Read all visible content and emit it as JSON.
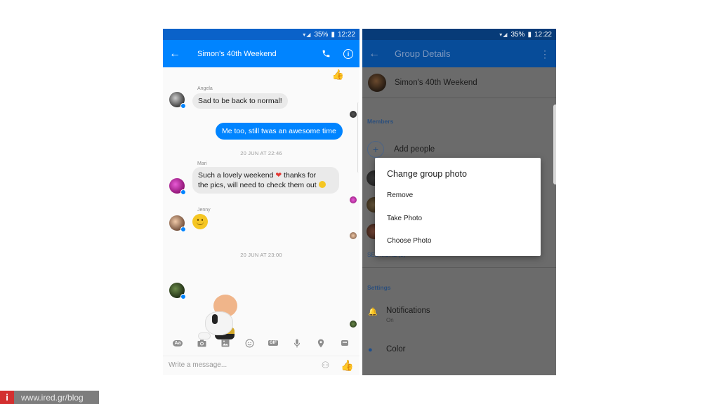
{
  "left_screen": {
    "status_bar": {
      "signal": "WiFi / signal",
      "battery": "35%",
      "time": "12:22"
    },
    "header": {
      "title": "Simon's 40th Weekend"
    },
    "colors": {
      "accent": "#0084ff",
      "status_bar": "#0a62c9",
      "incoming_bubble": "#eaeaea"
    },
    "messages": [
      {
        "type": "incoming",
        "sender": "Angela",
        "text": "Sad to be back to normal!"
      },
      {
        "type": "outgoing",
        "text": "Me too, still twas an awesome time"
      },
      {
        "type": "timestamp",
        "text": "20 JUN AT 22:46"
      },
      {
        "type": "incoming",
        "sender": "Mari",
        "text_line1": "Such a lovely weekend",
        "text_line1b": " thanks for",
        "text_line2": "the pics, will need to check them out"
      },
      {
        "type": "incoming",
        "sender": "Jenny",
        "text": "smiley emoji"
      },
      {
        "type": "timestamp",
        "text": "20 JUN AT 23:00"
      },
      {
        "type": "sticker",
        "text": "Charlie Brown hugging Snoopy sticker"
      }
    ],
    "toolbar": {
      "items": [
        "Aa",
        "camera",
        "gallery",
        "emoji",
        "GIF",
        "microphone",
        "location",
        "more"
      ],
      "aa_label": "Aa",
      "gif_label": "GIF",
      "more_label": "•••"
    },
    "composer": {
      "placeholder": "Write a message..."
    }
  },
  "right_screen": {
    "status_bar": {
      "battery": "35%",
      "time": "12:22"
    },
    "header": {
      "title": "Group Details"
    },
    "group": {
      "name": "Simon's 40th Weekend"
    },
    "members_label": "Members",
    "add_people_label": "Add people",
    "see_more_label": "SEE MORE (3)",
    "settings_label": "Settings",
    "settings": [
      {
        "title": "Notifications",
        "subtitle": "On",
        "icon": "bell-icon"
      },
      {
        "title": "Color",
        "icon": "palette-icon"
      }
    ],
    "dialog": {
      "title": "Change group photo",
      "options": [
        "Remove",
        "Take Photo",
        "Choose Photo"
      ]
    },
    "colors": {
      "appbar": "#074c99",
      "dim_overlay": "#6b6b6b",
      "section_label": "#2c4f7c"
    }
  },
  "watermark": {
    "icon": "i",
    "text": "www.ired.gr/blog"
  }
}
